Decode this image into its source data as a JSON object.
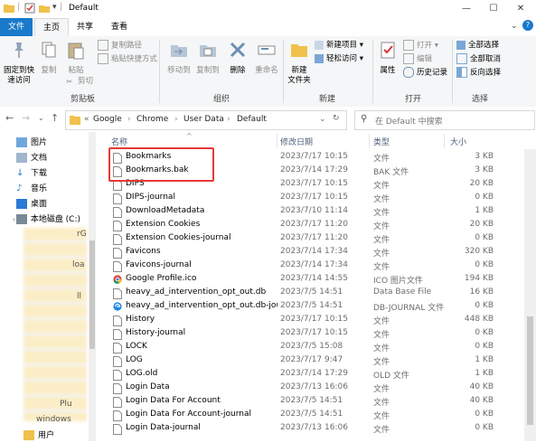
{
  "window": {
    "title": "Default",
    "controls": {
      "minimize": "—",
      "maximize": "☐",
      "close": "✕"
    }
  },
  "tabs": [
    "文件",
    "主页",
    "共享",
    "查看"
  ],
  "ribbon": {
    "clipboard": {
      "label": "剪贴板",
      "pin": "固定到快\n速访问",
      "copy": "复制",
      "paste": "粘贴",
      "copy_path": "复制路径",
      "paste_shortcut": "粘贴快捷方式",
      "cut": "剪切"
    },
    "organize": {
      "label": "组织",
      "move_to": "移动到",
      "copy_to": "复制到",
      "delete": "删除",
      "rename": "重命名"
    },
    "new": {
      "label": "新建",
      "new_folder": "新建\n文件夹",
      "new_item": "新建项目",
      "easy_access": "轻松访问"
    },
    "open": {
      "label": "打开",
      "properties": "属性",
      "open": "打开",
      "edit": "编辑",
      "history": "历史记录"
    },
    "select": {
      "label": "选择",
      "select_all": "全部选择",
      "select_none": "全部取消",
      "invert": "反向选择"
    }
  },
  "address": {
    "prefix": "«",
    "crumbs": [
      "Google",
      "Chrome",
      "User Data",
      "Default"
    ],
    "search_placeholder": "在 Default 中搜索"
  },
  "nav": {
    "items": [
      "图片",
      "文档",
      "下载",
      "音乐",
      "桌面",
      "本地磁盘 (C:)"
    ],
    "blurred_fragments": [
      "rG",
      "loa",
      "ll",
      "Plu",
      "windows"
    ],
    "bottom_item": "用户"
  },
  "columns": {
    "name": "名称",
    "date": "修改日期",
    "type": "类型",
    "size": "大小"
  },
  "files": [
    {
      "name": "Bookmarks",
      "date": "2023/7/17 10:15",
      "type": "文件",
      "size": "3 KB",
      "icon": "file"
    },
    {
      "name": "Bookmarks.bak",
      "date": "2023/7/14 17:29",
      "type": "BAK 文件",
      "size": "3 KB",
      "icon": "file"
    },
    {
      "name": "DIPS",
      "date": "2023/7/17 10:15",
      "type": "文件",
      "size": "20 KB",
      "icon": "file"
    },
    {
      "name": "DIPS-journal",
      "date": "2023/7/17 10:15",
      "type": "文件",
      "size": "0 KB",
      "icon": "file"
    },
    {
      "name": "DownloadMetadata",
      "date": "2023/7/10 11:14",
      "type": "文件",
      "size": "1 KB",
      "icon": "file"
    },
    {
      "name": "Extension Cookies",
      "date": "2023/7/17 11:20",
      "type": "文件",
      "size": "20 KB",
      "icon": "file"
    },
    {
      "name": "Extension Cookies-journal",
      "date": "2023/7/17 11:20",
      "type": "文件",
      "size": "0 KB",
      "icon": "file"
    },
    {
      "name": "Favicons",
      "date": "2023/7/14 17:34",
      "type": "文件",
      "size": "320 KB",
      "icon": "file"
    },
    {
      "name": "Favicons-journal",
      "date": "2023/7/14 17:34",
      "type": "文件",
      "size": "0 KB",
      "icon": "file"
    },
    {
      "name": "Google Profile.ico",
      "date": "2023/7/14 14:55",
      "type": "ICO 图片文件",
      "size": "194 KB",
      "icon": "chrome"
    },
    {
      "name": "heavy_ad_intervention_opt_out.db",
      "date": "2023/7/5 14:51",
      "type": "Data Base File",
      "size": "16 KB",
      "icon": "file"
    },
    {
      "name": "heavy_ad_intervention_opt_out.db-jou...",
      "date": "2023/7/5 14:51",
      "type": "DB-JOURNAL 文件",
      "size": "0 KB",
      "icon": "edge"
    },
    {
      "name": "History",
      "date": "2023/7/17 10:15",
      "type": "文件",
      "size": "448 KB",
      "icon": "file"
    },
    {
      "name": "History-journal",
      "date": "2023/7/17 10:15",
      "type": "文件",
      "size": "0 KB",
      "icon": "file"
    },
    {
      "name": "LOCK",
      "date": "2023/7/5 15:08",
      "type": "文件",
      "size": "0 KB",
      "icon": "file"
    },
    {
      "name": "LOG",
      "date": "2023/7/17 9:47",
      "type": "文件",
      "size": "1 KB",
      "icon": "file"
    },
    {
      "name": "LOG.old",
      "date": "2023/7/14 17:29",
      "type": "OLD 文件",
      "size": "1 KB",
      "icon": "file"
    },
    {
      "name": "Login Data",
      "date": "2023/7/13 16:06",
      "type": "文件",
      "size": "40 KB",
      "icon": "file"
    },
    {
      "name": "Login Data For Account",
      "date": "2023/7/5 14:51",
      "type": "文件",
      "size": "40 KB",
      "icon": "file"
    },
    {
      "name": "Login Data For Account-journal",
      "date": "2023/7/5 14:51",
      "type": "文件",
      "size": "0 KB",
      "icon": "file"
    },
    {
      "name": "Login Data-journal",
      "date": "2023/7/13 16:06",
      "type": "文件",
      "size": "0 KB",
      "icon": "file"
    }
  ],
  "colors": {
    "accent": "#1979ca",
    "highlight": "#e53935",
    "folder": "#f0c14b",
    "header_text": "#4c607a"
  }
}
